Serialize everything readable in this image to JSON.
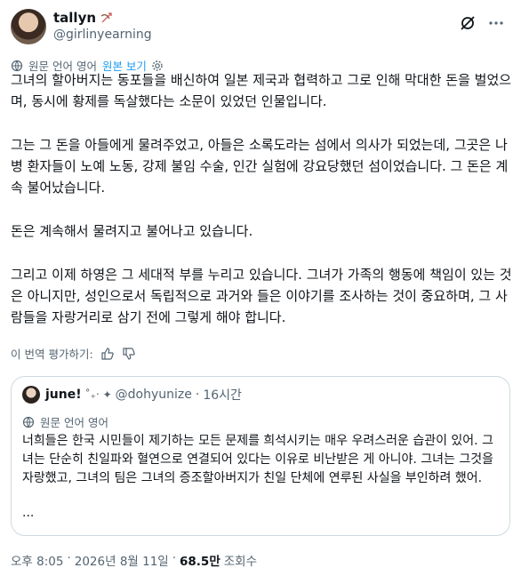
{
  "author": {
    "display_name": "tallyn",
    "handle": "@girlinyearning"
  },
  "translation_bar": {
    "label": "원문 언어 영어",
    "show_original": "원본 보기"
  },
  "body": {
    "paragraphs": [
      "그녀의 할아버지는 동포들을 배신하여 일본 제국과 협력하고 그로 인해 막대한 돈을 벌었으며, 동시에 황제를 독살했다는 소문이 있었던 인물입니다.",
      "그는 그 돈을 아들에게 물려주었고, 아들은 소록도라는 섬에서 의사가 되었는데, 그곳은 나병 환자들이 노예 노동, 강제 불임 수술, 인간 실험에 강요당했던 섬이었습니다. 그 돈은 계속 불어났습니다.",
      "돈은 계속해서 물려지고 불어나고 있습니다.",
      "그리고 이제 하영은 그 세대적 부를 누리고 있습니다. 그녀가 가족의 행동에 책임이 있는 것은 아니지만, 성인으로서 독립적으로 과거와 들은 이야기를 조사하는 것이 중요하며, 그 사람들을 자랑거리로 삼기 전에 그렇게 해야 합니다."
    ]
  },
  "rate_translation": {
    "label": "이 번역 평가하기:"
  },
  "quote": {
    "display_name": "june!",
    "decoration": "˚₊‧ ✦",
    "handle": "@dohyunize",
    "dot": "·",
    "time": "16시간",
    "translation_label": "원문 언어 영어",
    "text": "너희들은 한국 시민들이 제기하는 모든 문제를 희석시키는 매우 우려스러운 습관이 있어. 그녀는 단순히 친일파와 혈연으로 연결되어 있다는 이유로 비난받은 게 아니야. 그녀는 그것을 자랑했고, 그녀의 팀은 그녀의 증조할아버지가 친일 단체에 연루된 사실을 부인하려 했어.",
    "ellipsis": "..."
  },
  "meta": {
    "time": "오후 8:05",
    "dot1": "·",
    "date": "2026년 8월 11일",
    "dot2": "·",
    "views_count": "68.5만",
    "views_label": "조회수"
  },
  "colors": {
    "link": "#1d9bf0",
    "secondary_text": "#536471",
    "border": "#cfd9de"
  },
  "icons": [
    "bow-arrow-icon",
    "grok-icon",
    "more-icon",
    "globe-icon",
    "gear-icon",
    "thumbs-up-icon",
    "thumbs-down-icon"
  ]
}
